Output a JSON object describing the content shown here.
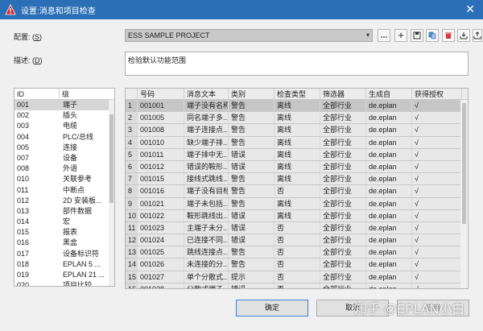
{
  "window": {
    "title": "设置:消息和项目检查",
    "close_glyph": "✕"
  },
  "scheme": {
    "label": "配置: (",
    "hotkey": "S",
    "label_end": ")",
    "value": "ESS SAMPLE PROJECT",
    "dropdown_glyph": "▾"
  },
  "description": {
    "label": "描述: (",
    "hotkey": "D",
    "label_end": ")",
    "value": "检验默认功能范围"
  },
  "toolbar": {
    "new_glyph": "+"
  },
  "left_list": {
    "headers": [
      "ID",
      "级"
    ],
    "rows": [
      {
        "id": "001",
        "name": "端子"
      },
      {
        "id": "002",
        "name": "插头"
      },
      {
        "id": "003",
        "name": "电缆"
      },
      {
        "id": "004",
        "name": "PLC/总线"
      },
      {
        "id": "005",
        "name": "连接"
      },
      {
        "id": "007",
        "name": "设备"
      },
      {
        "id": "008",
        "name": "外语"
      },
      {
        "id": "010",
        "name": "关联参考"
      },
      {
        "id": "011",
        "name": "中断点"
      },
      {
        "id": "012",
        "name": "2D 安装板..."
      },
      {
        "id": "013",
        "name": "部件数据"
      },
      {
        "id": "014",
        "name": "宏"
      },
      {
        "id": "015",
        "name": "报表"
      },
      {
        "id": "016",
        "name": "黑盒"
      },
      {
        "id": "017",
        "name": "设备标识符"
      },
      {
        "id": "018",
        "name": "EPLAN 5 ..."
      },
      {
        "id": "019",
        "name": "EPLAN 21 ..."
      },
      {
        "id": "020",
        "name": "项目比较"
      }
    ]
  },
  "grid": {
    "headers": [
      "号码",
      "消息文本",
      "类别",
      "检查类型",
      "筛选器",
      "生成自",
      "获得授权"
    ],
    "rows": [
      {
        "n": "1",
        "id": "001001",
        "text": "端子没有名称",
        "cat": "警告",
        "type": "离线",
        "filter": "全部行业",
        "src": "de.eplan",
        "auth": "√"
      },
      {
        "n": "2",
        "id": "001005",
        "text": "同名端子多...",
        "cat": "警告",
        "type": "离线",
        "filter": "全部行业",
        "src": "de.eplan",
        "auth": "√"
      },
      {
        "n": "3",
        "id": "001008",
        "text": "端子连接点...",
        "cat": "警告",
        "type": "离线",
        "filter": "全部行业",
        "src": "de.eplan",
        "auth": "√"
      },
      {
        "n": "4",
        "id": "001010",
        "text": "缺少端子排...",
        "cat": "警告",
        "type": "离线",
        "filter": "全部行业",
        "src": "de.eplan",
        "auth": "√"
      },
      {
        "n": "5",
        "id": "001011",
        "text": "端子排中无...",
        "cat": "错误",
        "type": "离线",
        "filter": "全部行业",
        "src": "de.eplan",
        "auth": "√"
      },
      {
        "n": "6",
        "id": "001012",
        "text": "错误的鞍形...",
        "cat": "错误",
        "type": "离线",
        "filter": "全部行业",
        "src": "de.eplan",
        "auth": "√"
      },
      {
        "n": "7",
        "id": "001015",
        "text": "接线式跳线...",
        "cat": "警告",
        "type": "离线",
        "filter": "全部行业",
        "src": "de.eplan",
        "auth": "√"
      },
      {
        "n": "8",
        "id": "001016",
        "text": "端子没有目标",
        "cat": "警告",
        "type": "否",
        "filter": "全部行业",
        "src": "de.eplan",
        "auth": "√"
      },
      {
        "n": "9",
        "id": "001021",
        "text": "端子未包括...",
        "cat": "警告",
        "type": "离线",
        "filter": "全部行业",
        "src": "de.eplan",
        "auth": "√"
      },
      {
        "n": "10",
        "id": "001022",
        "text": "鞍形跳线出...",
        "cat": "错误",
        "type": "离线",
        "filter": "全部行业",
        "src": "de.eplan",
        "auth": "√"
      },
      {
        "n": "11",
        "id": "001023",
        "text": "主端子未分...",
        "cat": "错误",
        "type": "否",
        "filter": "全部行业",
        "src": "de.eplan",
        "auth": "√"
      },
      {
        "n": "12",
        "id": "001024",
        "text": "已连接不同...",
        "cat": "错误",
        "type": "否",
        "filter": "全部行业",
        "src": "de.eplan",
        "auth": "√"
      },
      {
        "n": "13",
        "id": "001025",
        "text": "跳线连接点...",
        "cat": "警告",
        "type": "否",
        "filter": "全部行业",
        "src": "de.eplan",
        "auth": "√"
      },
      {
        "n": "14",
        "id": "001026",
        "text": "未连接的分...",
        "cat": "警告",
        "type": "否",
        "filter": "全部行业",
        "src": "de.eplan",
        "auth": "√"
      },
      {
        "n": "15",
        "id": "001027",
        "text": "单个分散式...",
        "cat": "提示",
        "type": "否",
        "filter": "全部行业",
        "src": "de.eplan",
        "auth": "√"
      },
      {
        "n": "16",
        "id": "001028",
        "text": "分散式端子...",
        "cat": "错误",
        "type": "否",
        "filter": "全部行业",
        "src": "de.eplan",
        "auth": "√"
      }
    ]
  },
  "buttons": {
    "ok": "确定",
    "cancel": "取消",
    "apply": "应用"
  },
  "watermark": "知乎 @EPLAN小白",
  "colors": {
    "titlebar": "#2b6fb6",
    "selected_row": "#c6c6c6",
    "warning_icon": "#d9232a",
    "delete_icon": "#d43b3b"
  }
}
